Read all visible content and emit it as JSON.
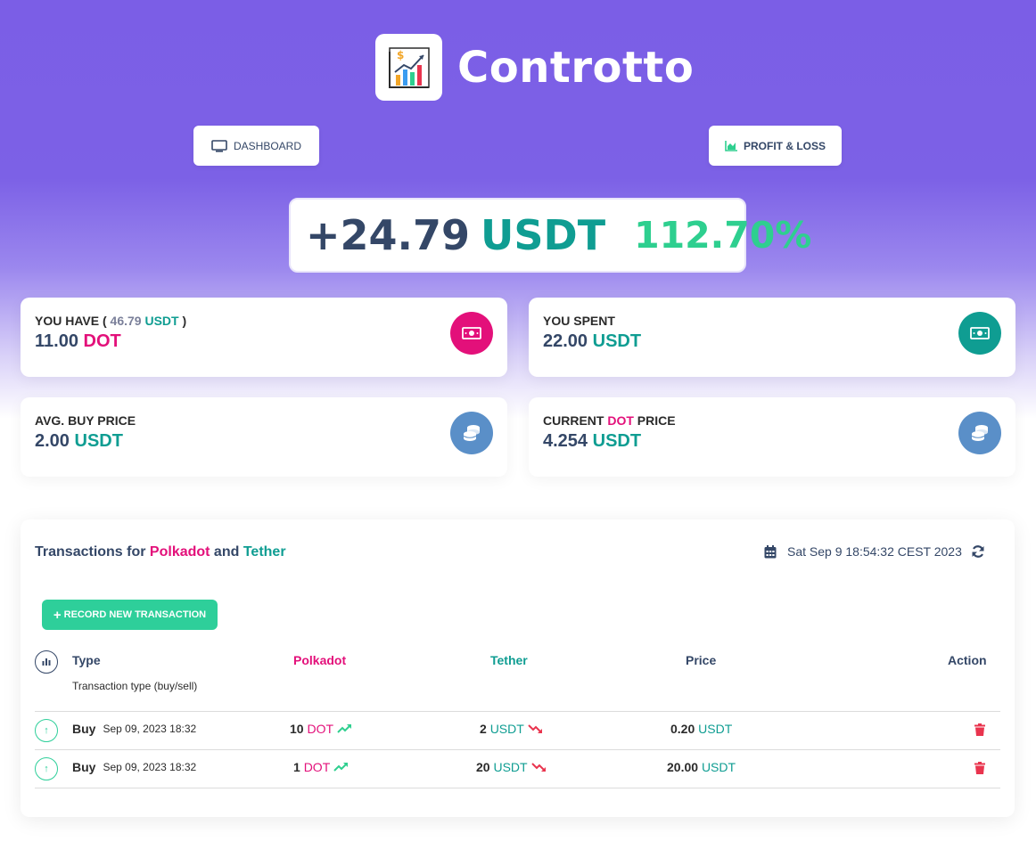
{
  "brand": {
    "name": "Contrott",
    "name_suffix": "o"
  },
  "nav": {
    "dashboard": "DASHBOARD",
    "profit_loss": "PROFIT & LOSS"
  },
  "pnl": {
    "amount": "+24.79",
    "currency": "USDT",
    "percent": "112.70%"
  },
  "cards": {
    "have": {
      "label_pre": "YOU HAVE ( ",
      "value_in_usdt": "46.79",
      "usdt": "USDT",
      "label_post": " )",
      "amount": "11.00",
      "unit": "DOT"
    },
    "spent": {
      "label": "YOU SPENT",
      "amount": "22.00",
      "unit": "USDT"
    },
    "avg": {
      "label": "AVG. BUY PRICE",
      "amount": "2.00",
      "unit": "USDT"
    },
    "current": {
      "label_pre": "CURRENT ",
      "coin": "DOT",
      "label_post": " PRICE",
      "amount": "4.254",
      "unit": "USDT"
    }
  },
  "transactions": {
    "title_pre": "Transactions for ",
    "coin_a": "Polkadot",
    "title_mid": " and ",
    "coin_b": "Tether",
    "timestamp": "Sat Sep 9 18:54:32 CEST 2023",
    "record_button": "RECORD NEW TRANSACTION",
    "headers": {
      "type": "Type",
      "type_sub": "Transaction type (buy/sell)",
      "polkadot": "Polkadot",
      "tether": "Tether",
      "price": "Price",
      "action": "Action"
    },
    "rows": [
      {
        "type": "Buy",
        "date": "Sep 09, 2023 18:32",
        "dot_amount": "10",
        "dot_unit": "DOT",
        "usdt_amount": "2",
        "usdt_unit": "USDT",
        "price": "0.20",
        "price_unit": "USDT"
      },
      {
        "type": "Buy",
        "date": "Sep 09, 2023 18:32",
        "dot_amount": "1",
        "dot_unit": "DOT",
        "usdt_amount": "20",
        "usdt_unit": "USDT",
        "price": "20.00",
        "price_unit": "USDT"
      }
    ]
  },
  "colors": {
    "accent_purple": "#7b5ee6",
    "pink": "#e3107a",
    "teal": "#0f9d92",
    "green": "#2ecf9a",
    "red": "#e9344e",
    "steel": "#5a8fc8"
  }
}
